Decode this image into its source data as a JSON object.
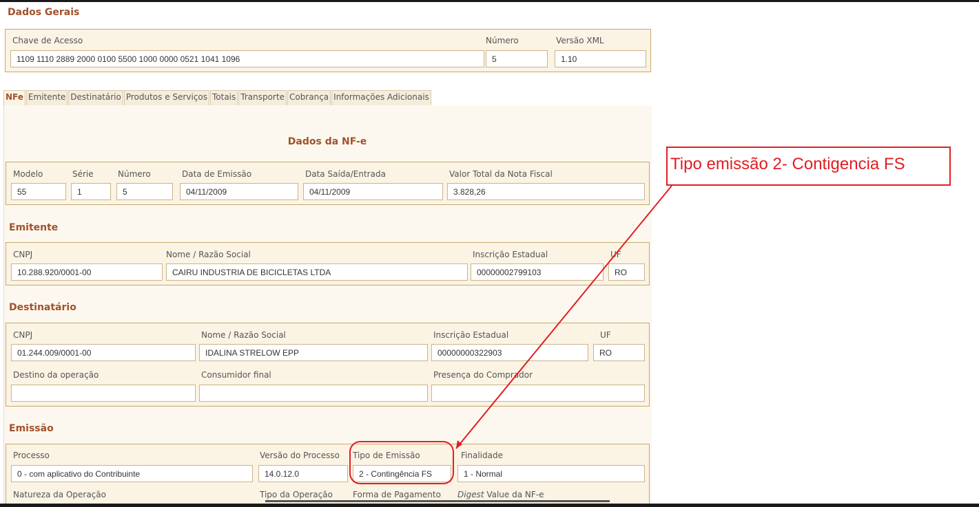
{
  "general": {
    "title": "Dados Gerais",
    "access_key_label": "Chave de Acesso",
    "access_key": "1109 1110 2889 2000 0100 5500 1000 0000 0521 1041 1096",
    "number_label": "Número",
    "number": "5",
    "xml_version_label": "Versão XML",
    "xml_version": "1.10"
  },
  "tabs": [
    "NFe",
    "Emitente",
    "Destinatário",
    "Produtos e Serviços",
    "Totais",
    "Transporte",
    "Cobrança",
    "Informações Adicionais"
  ],
  "nfe": {
    "section_title": "Dados da NF-e",
    "model_label": "Modelo",
    "model": "55",
    "series_label": "Série",
    "series": "1",
    "number_label": "Número",
    "number": "5",
    "issue_date_label": "Data de Emissão",
    "issue_date": "04/11/2009",
    "exit_date_label": "Data Saída/Entrada",
    "exit_date": "04/11/2009",
    "total_label": "Valor Total da Nota Fiscal",
    "total": "3.828,26"
  },
  "issuer": {
    "title": "Emitente",
    "cnpj_label": "CNPJ",
    "cnpj": "10.288.920/0001-00",
    "name_label": "Nome / Razão Social",
    "name": "CAIRU INDUSTRIA DE BICICLETAS LTDA",
    "ie_label": "Inscrição Estadual",
    "ie": "00000002799103",
    "uf_label": "UF",
    "uf": "RO"
  },
  "recipient": {
    "title": "Destinatário",
    "cnpj_label": "CNPJ",
    "cnpj": "01.244.009/0001-00",
    "name_label": "Nome / Razão Social",
    "name": "IDALINA STRELOW EPP",
    "ie_label": "Inscrição Estadual",
    "ie": "00000000322903",
    "uf_label": "UF",
    "uf": "RO",
    "destination_label": "Destino da operação",
    "destination": "",
    "final_consumer_label": "Consumidor final",
    "final_consumer": "",
    "buyer_presence_label": "Presença do Comprador",
    "buyer_presence": ""
  },
  "emission": {
    "title": "Emissão",
    "process_label": "Processo",
    "process": "0 - com aplicativo do Contribuinte",
    "process_version_label": "Versão do Processo",
    "process_version": "14.0.12.0",
    "emission_type_label": "Tipo de Emissão",
    "emission_type": "2 - Contingência FS",
    "purpose_label": "Finalidade",
    "purpose": "1 - Normal",
    "nature_label": "Natureza da Operação",
    "operation_type_label": "Tipo da Operação",
    "payment_label": "Forma de Pagamento",
    "digest_label_italic": "Digest",
    "digest_label_rest": " Value da NF-e"
  },
  "annotation": {
    "text": "Tipo emissão 2- Contigencia FS",
    "color": "#e21d23"
  },
  "colors": {
    "heading": "#a0522d",
    "fieldset_bg": "#fbf3e4",
    "fieldset_border": "#c5a96b"
  }
}
